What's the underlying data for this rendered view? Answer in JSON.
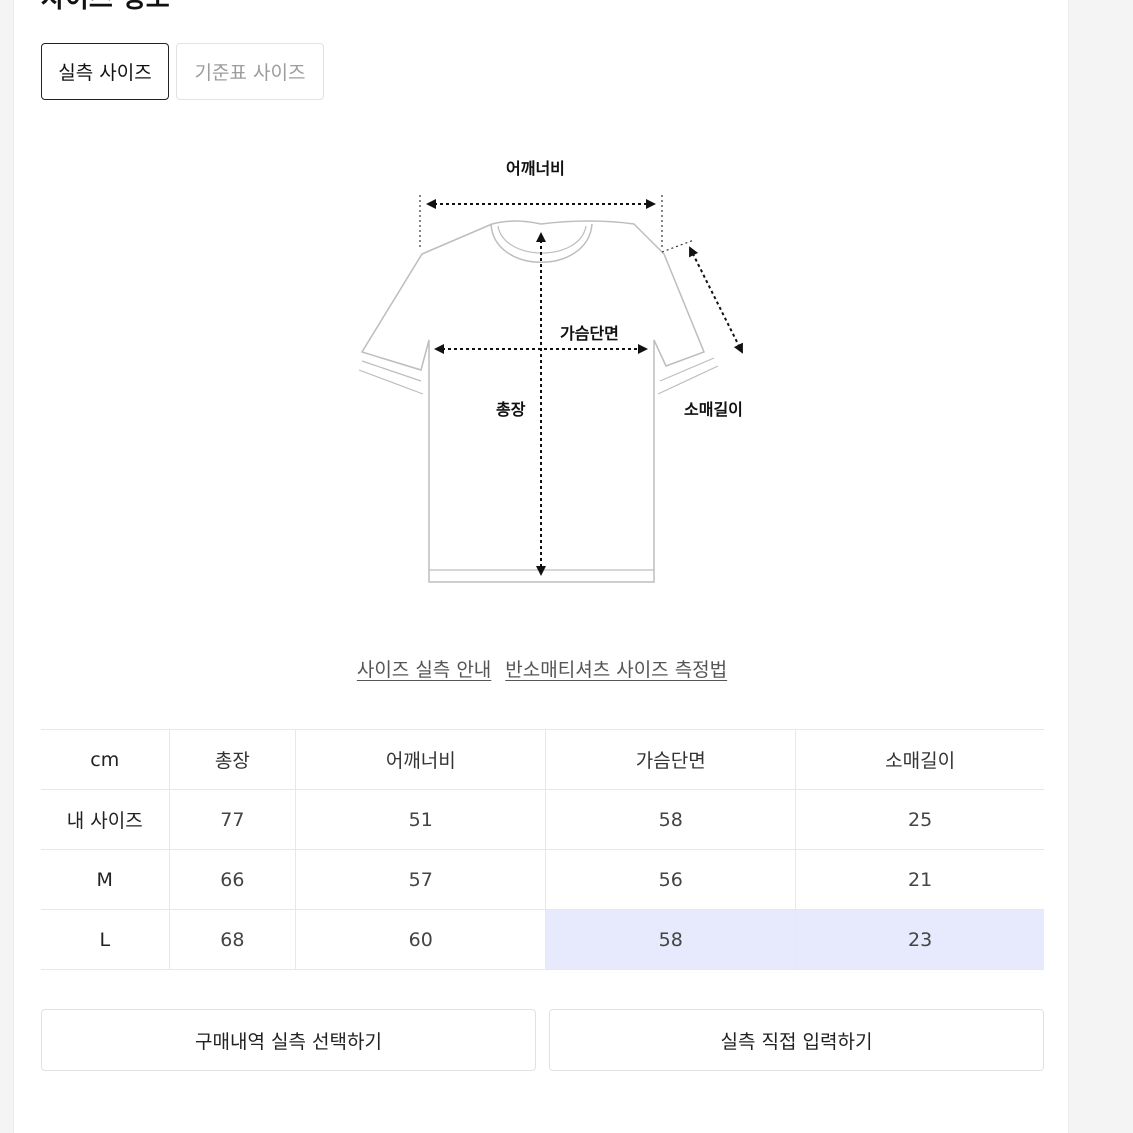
{
  "section": {
    "title": "사이즈 정보"
  },
  "tabs": [
    {
      "label": "실측 사이즈",
      "active": true
    },
    {
      "label": "기준표 사이즈",
      "active": false
    }
  ],
  "diagram": {
    "shoulder_label": "어깨너비",
    "chest_label": "가슴단면",
    "length_label": "총장",
    "sleeve_label": "소매길이"
  },
  "links": [
    {
      "label": "사이즈 실측 안내"
    },
    {
      "label": "반소매티셔츠 사이즈 측정법"
    }
  ],
  "table": {
    "headers": [
      "cm",
      "총장",
      "어깨너비",
      "가슴단면",
      "소매길이"
    ],
    "rows": [
      {
        "label": "내 사이즈",
        "values": [
          "77",
          "51",
          "58",
          "25"
        ]
      },
      {
        "label": "M",
        "values": [
          "66",
          "57",
          "56",
          "21"
        ]
      },
      {
        "label": "L",
        "values": [
          "68",
          "60",
          "58",
          "23"
        ]
      }
    ],
    "highlight_color": "#e6eafc"
  },
  "actions": {
    "purchase_select": "구매내역 실측 선택하기",
    "direct_input": "실측 직접 입력하기"
  }
}
